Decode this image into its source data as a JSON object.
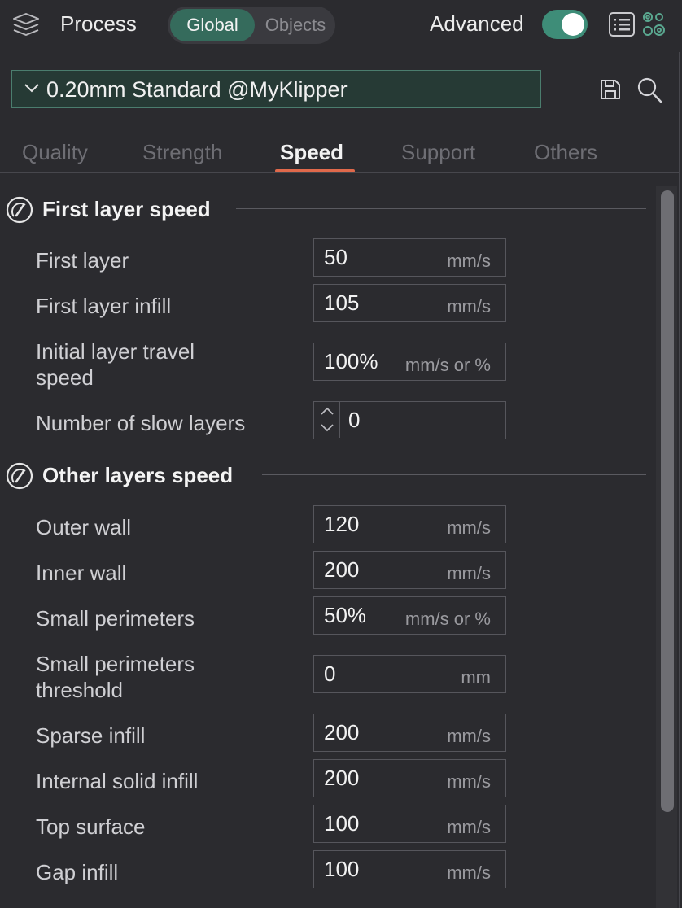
{
  "header": {
    "title": "Process",
    "scope_tabs": [
      "Global",
      "Objects"
    ],
    "active_scope": "Global",
    "advanced_label": "Advanced",
    "advanced_enabled": true
  },
  "preset": {
    "name": "0.20mm Standard @MyKlipper"
  },
  "tabs": [
    "Quality",
    "Strength",
    "Speed",
    "Support",
    "Others"
  ],
  "active_tab": "Speed",
  "colors": {
    "accent_green": "#356b5c",
    "toggle_green": "#3e8d78",
    "tab_underline": "#e0694b",
    "background": "#2b2b2f"
  },
  "sections": [
    {
      "title": "First layer speed",
      "icon": "speedometer-icon",
      "rows": [
        {
          "label": "First layer",
          "value": "50",
          "unit": "mm/s"
        },
        {
          "label": "First layer infill",
          "value": "105",
          "unit": "mm/s"
        },
        {
          "label": "Initial layer travel\nspeed",
          "value": "100%",
          "unit": "mm/s or %"
        },
        {
          "label": "Number of slow layers",
          "value": "0",
          "unit": "",
          "spinner": true
        }
      ]
    },
    {
      "title": "Other layers speed",
      "icon": "speedometer-icon",
      "rows": [
        {
          "label": "Outer wall",
          "value": "120",
          "unit": "mm/s"
        },
        {
          "label": "Inner wall",
          "value": "200",
          "unit": "mm/s"
        },
        {
          "label": "Small perimeters",
          "value": "50%",
          "unit": "mm/s or %"
        },
        {
          "label": "Small perimeters\nthreshold",
          "value": "0",
          "unit": "mm"
        },
        {
          "label": "Sparse infill",
          "value": "200",
          "unit": "mm/s"
        },
        {
          "label": "Internal solid infill",
          "value": "200",
          "unit": "mm/s"
        },
        {
          "label": "Top surface",
          "value": "100",
          "unit": "mm/s"
        },
        {
          "label": "Gap infill",
          "value": "100",
          "unit": "mm/s"
        }
      ]
    }
  ]
}
